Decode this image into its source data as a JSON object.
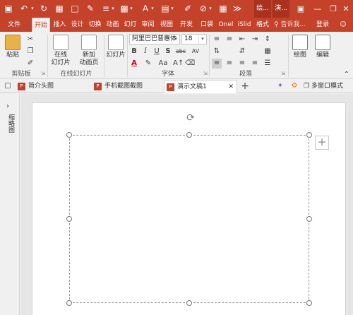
{
  "titlebar": {
    "context_tab_1": "绘...",
    "context_tab_2": "演...",
    "colors": {
      "accent": "#c4412a",
      "context": "#a8321f"
    }
  },
  "tabs": [
    {
      "label": "文件"
    },
    {
      "label": "开始",
      "active": true
    },
    {
      "label": "插入"
    },
    {
      "label": "设计"
    },
    {
      "label": "切换"
    },
    {
      "label": "动画"
    },
    {
      "label": "幻灯"
    },
    {
      "label": "审阅"
    },
    {
      "label": "视图"
    },
    {
      "label": "开发"
    },
    {
      "label": "口袋"
    },
    {
      "label": "Onel"
    },
    {
      "label": "iSlid"
    },
    {
      "label": "格式"
    }
  ],
  "tell_me": "告诉我...",
  "login": "登录",
  "ribbon": {
    "clipboard": {
      "paste": "粘贴",
      "label": "剪贴板"
    },
    "online_slides": {
      "online": "在线",
      "online_sub": "幻灯片",
      "new": "新加",
      "new_sub": "动画页",
      "label": "在线幻灯片"
    },
    "slides": {
      "layout": "幻灯片"
    },
    "font": {
      "name": "阿里巴巴普惠体",
      "size": "18",
      "label": "字体",
      "bold": "B",
      "italic": "I",
      "underline": "U",
      "strike": "S",
      "shadow": "abc",
      "spacing": "AV",
      "color_a": "A",
      "case": "Aa"
    },
    "paragraph": {
      "label": "段落"
    },
    "drawing": {
      "label": "绘图"
    },
    "editing": {
      "label": "编辑"
    }
  },
  "doc_tabs": [
    {
      "label": "简介头图"
    },
    {
      "label": "手机截图截图"
    },
    {
      "label": "演示文稿1",
      "active": true
    }
  ],
  "multi_window": "多窗口模式",
  "side_label": "缩略图"
}
